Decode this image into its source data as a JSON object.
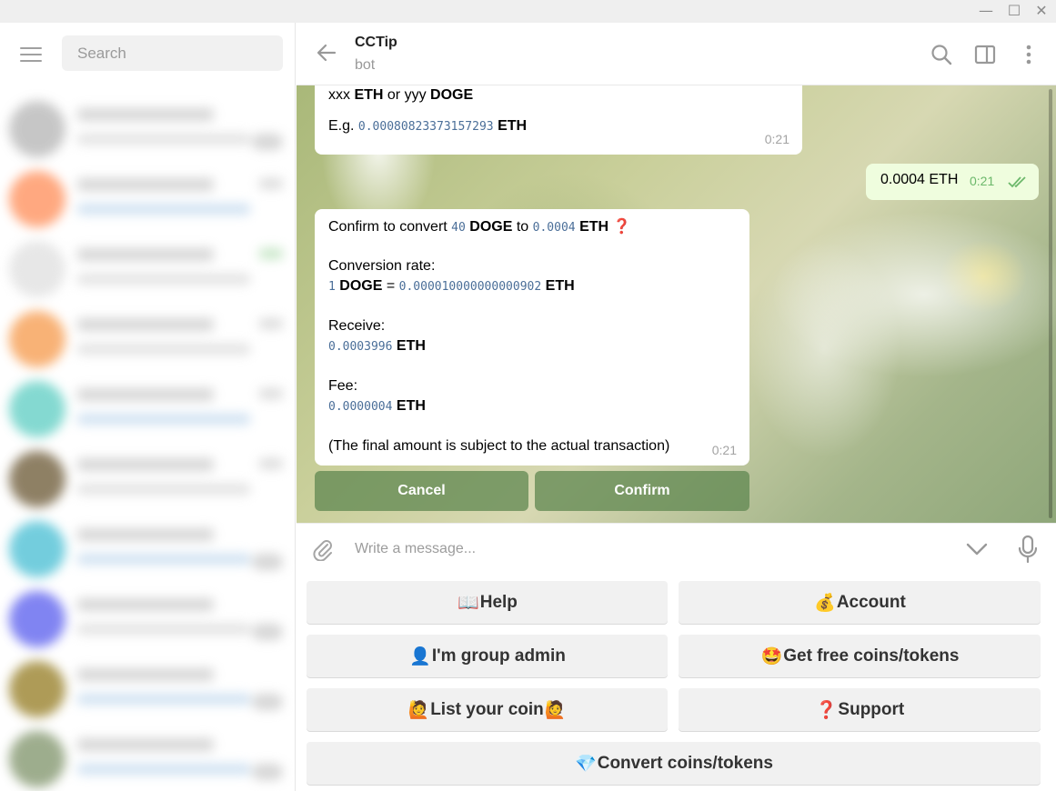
{
  "window": {
    "minimize_glyph": "—",
    "maximize_glyph": "☐",
    "close_glyph": "✕"
  },
  "sidebar": {
    "search_placeholder": "Search"
  },
  "chat": {
    "title": "CCTip",
    "status": "bot"
  },
  "messages": {
    "first": {
      "line1_prefix": "xxx ",
      "line1_unit1": "ETH",
      "line1_mid": " or yyy ",
      "line1_unit2": "DOGE",
      "line2_prefix": "E.g. ",
      "line2_value": "0.00080823373157293",
      "line2_unit": "ETH",
      "time": "0:21"
    },
    "outgoing": {
      "text": "0.0004 ETH",
      "time": "0:21"
    },
    "confirm": {
      "l1_a": "Confirm to convert ",
      "l1_amount": "40",
      "l1_unit": "DOGE",
      "l1_to": " to ",
      "l1_value": "0.0004",
      "l1_unit2": "ETH",
      "l1_emoji": "❓",
      "rate_label": "Conversion rate:",
      "rate_one": "1",
      "rate_unit": "DOGE",
      "rate_eq": " = ",
      "rate_value": "0.000010000000000902",
      "rate_unit2": "ETH",
      "receive_label": "Receive:",
      "receive_value": "0.0003996",
      "receive_unit": "ETH",
      "fee_label": "Fee:",
      "fee_value": "0.0000004",
      "fee_unit": "ETH",
      "note": "(The final amount is subject to the actual transaction)",
      "time": "0:21"
    },
    "inline_buttons": {
      "cancel": "Cancel",
      "confirm": "Confirm"
    }
  },
  "composer": {
    "placeholder": "Write a message..."
  },
  "keyboard": {
    "help_emoji": "📖",
    "help": "Help",
    "account_emoji": "💰",
    "account": "Account",
    "admin_emoji": "👤",
    "admin": "I'm group admin",
    "free_emoji": "🤩",
    "free": "Get free coins/tokens",
    "list_emoji1": "🙋",
    "list": "List your coin",
    "list_emoji2": "🙋",
    "support_emoji": "❓",
    "support": "Support",
    "convert_emoji": "💎",
    "convert": "Convert coins/tokens"
  },
  "colors": {
    "link_mono": "#4a6e98",
    "outgoing_bg": "#effdde",
    "accent_green": "#6cb86b",
    "inline_button_bg": "#5f8750"
  }
}
